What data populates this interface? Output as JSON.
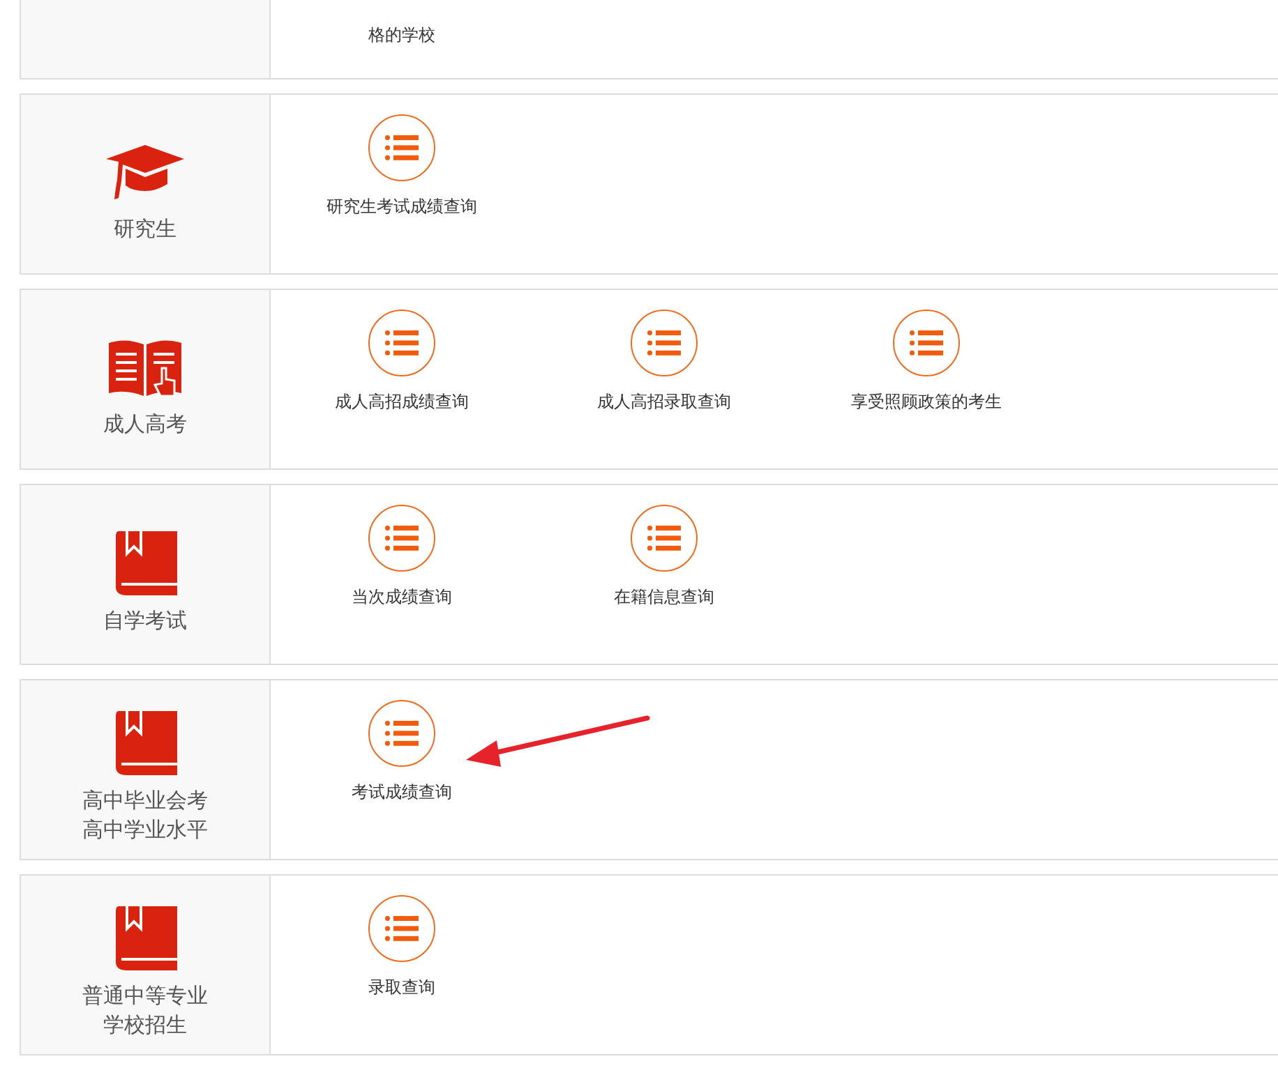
{
  "sections": [
    {
      "kind": "partial",
      "items": [
        {
          "text": "格的学校"
        }
      ]
    },
    {
      "kind": "cap",
      "label": [
        "研究生"
      ],
      "items": [
        {
          "text": "研究生考试成绩查询"
        }
      ]
    },
    {
      "kind": "open-book",
      "label": [
        "成人高考"
      ],
      "items": [
        {
          "text": "成人高招成绩查询"
        },
        {
          "text": "成人高招录取查询"
        },
        {
          "text": "享受照顾政策的考生"
        }
      ]
    },
    {
      "kind": "book",
      "label": [
        "自学考试"
      ],
      "items": [
        {
          "text": "当次成绩查询"
        },
        {
          "text": "在籍信息查询"
        }
      ]
    },
    {
      "kind": "book",
      "label": [
        "高中毕业会考",
        "高中学业水平"
      ],
      "items": [
        {
          "text": "考试成绩查询"
        }
      ]
    },
    {
      "kind": "book",
      "label": [
        "普通中等专业",
        "学校招生"
      ],
      "items": [
        {
          "text": "录取查询"
        }
      ]
    }
  ],
  "annotation": {
    "kind": "arrow"
  }
}
